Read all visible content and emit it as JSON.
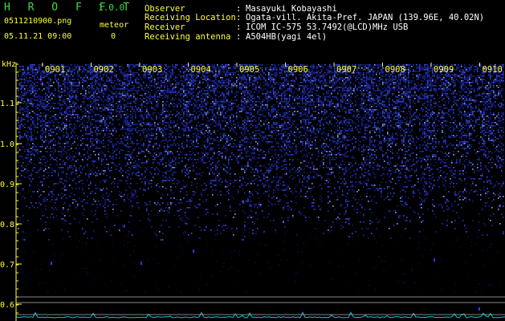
{
  "header": {
    "app_title": "H R O F F T",
    "version": "1.0.0",
    "filename": "0511210900.png",
    "datetime": "05.11.21 09:00",
    "meteor_label": "meteor",
    "meteor_count": "0"
  },
  "info": [
    {
      "label": "Observer",
      "colon": ":",
      "value": "Masayuki Kobayashi"
    },
    {
      "label": "Receiving Location",
      "colon": ":",
      "value": "Ogata-vill. Akita-Pref. JAPAN (139.96E, 40.02N)"
    },
    {
      "label": "Receiver",
      "colon": ":",
      "value": "ICOM IC-575 53.7492(@LCD)MHz USB"
    },
    {
      "label": "Receiving antenna",
      "colon": ":",
      "value": "A504HB(yagi 4el)"
    }
  ],
  "spectrogram": {
    "y_unit": "kHz",
    "y_ticks": [
      "1.1",
      "1.0",
      "0.9",
      "0.8",
      "0.7",
      "0.6"
    ],
    "y_tick_values": [
      1.1,
      1.0,
      0.9,
      0.8,
      0.7,
      0.6
    ],
    "time_labels": [
      "0901",
      "0902",
      "0903",
      "0904",
      "0905",
      "0906",
      "0907",
      "0908",
      "0909",
      "0910"
    ],
    "colors": {
      "label_yellow": "#ffff33",
      "title_green": "#3ddc3d",
      "noise_blue": "#2a3cff",
      "baseline_cyan": "#00e0e0"
    }
  }
}
